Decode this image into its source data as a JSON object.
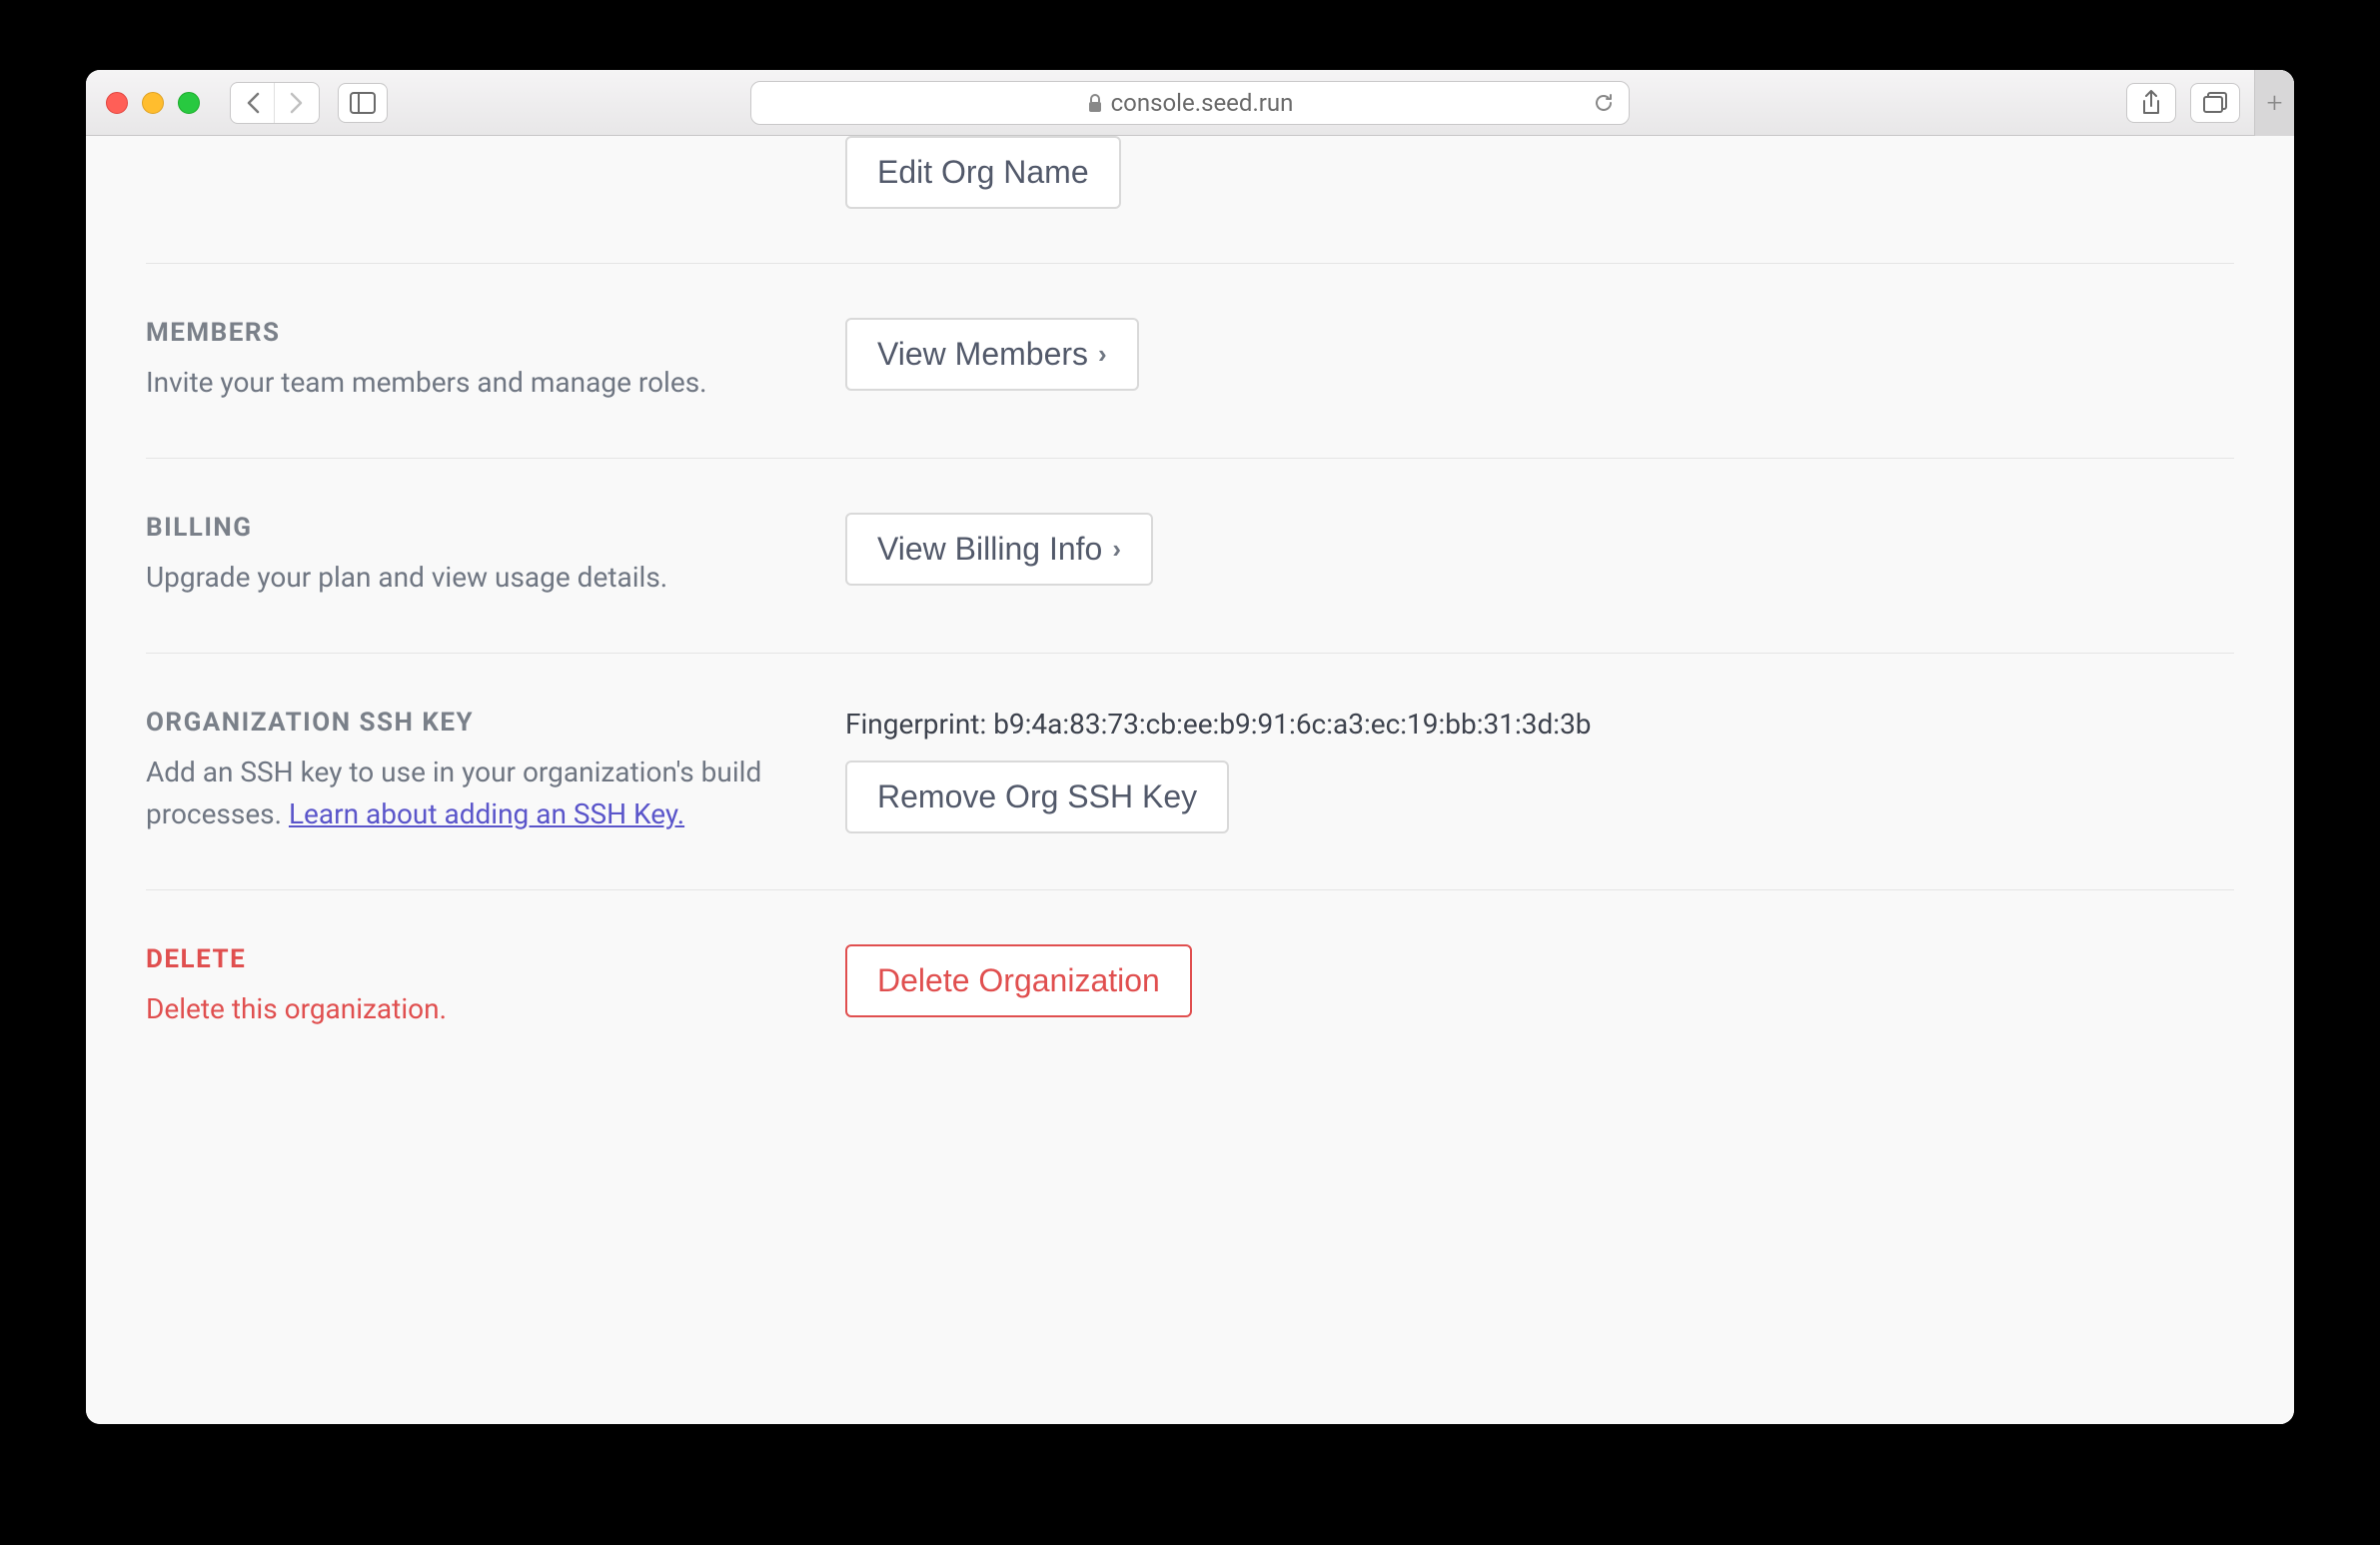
{
  "browser": {
    "url": "console.seed.run"
  },
  "sections": {
    "orgName": {
      "editButton": "Edit Org Name"
    },
    "members": {
      "title": "MEMBERS",
      "description": "Invite your team members and manage roles.",
      "button": "View Members"
    },
    "billing": {
      "title": "BILLING",
      "description": "Upgrade your plan and view usage details.",
      "button": "View Billing Info"
    },
    "sshKey": {
      "title": "ORGANIZATION SSH KEY",
      "descPrefix": "Add an SSH key to use in your organization's build processes. ",
      "linkText": "Learn about adding an SSH Key.",
      "fingerprintLabel": "Fingerprint: ",
      "fingerprint": "b9:4a:83:73:cb:ee:b9:91:6c:a3:ec:19:bb:31:3d:3b",
      "button": "Remove Org SSH Key"
    },
    "delete": {
      "title": "DELETE",
      "description": "Delete this organization.",
      "button": "Delete Organization"
    }
  }
}
